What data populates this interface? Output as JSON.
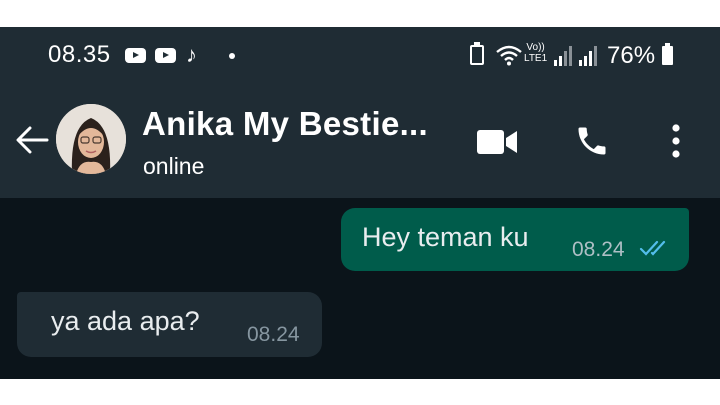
{
  "status_bar": {
    "time": "08.35",
    "network_top": "Vo))",
    "network_bottom": "LTE1",
    "battery_percent": "76%",
    "notification_icons": [
      "youtube-icon",
      "youtube-icon",
      "tiktok-icon"
    ]
  },
  "header": {
    "contact_name": "Anika My Bestie...",
    "status": "online"
  },
  "messages": [
    {
      "direction": "outgoing",
      "text": "Hey teman ku",
      "time": "08.24",
      "read": true
    },
    {
      "direction": "incoming",
      "text": "ya ada apa?",
      "time": "08.24"
    }
  ],
  "colors": {
    "bar_bg": "#1f2c34",
    "chat_bg": "#0b141a",
    "outgoing_bubble": "#005c4b",
    "incoming_bubble": "#1f2c34",
    "read_ticks": "#53bdeb"
  }
}
